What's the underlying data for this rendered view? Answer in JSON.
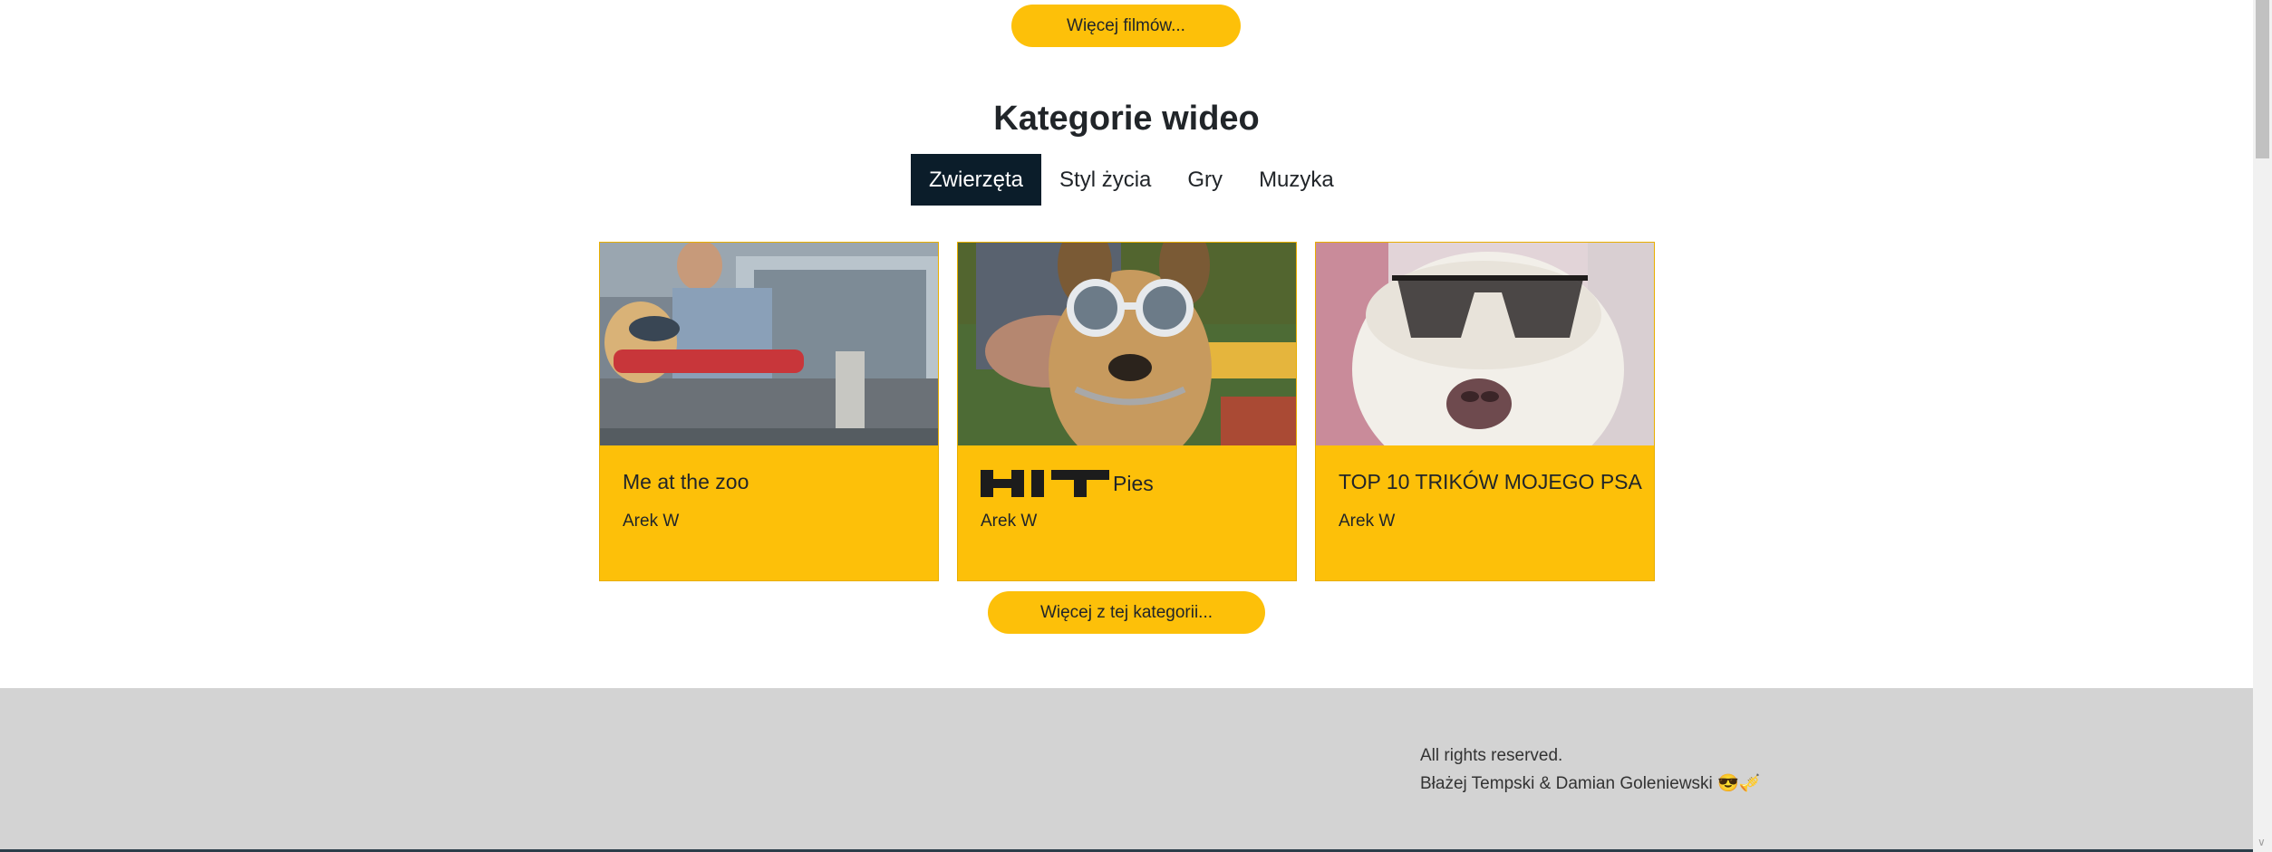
{
  "buttons": {
    "more_films": "Więcej filmów...",
    "more_category": "Więcej z tej kategorii..."
  },
  "categories": {
    "title": "Kategorie wideo",
    "tabs": [
      "Zwierzęta",
      "Styl życia",
      "Gry",
      "Muzyka"
    ],
    "active_tab": "Zwierzęta"
  },
  "videos": [
    {
      "title": "Me at the zoo",
      "author": "Arek W",
      "badge": ""
    },
    {
      "title": "Pies",
      "author": "Arek W",
      "badge": "HIT"
    },
    {
      "title": "TOP 10 TRIKÓW MOJEGO PSA",
      "author": "Arek W",
      "badge": ""
    }
  ],
  "footer": {
    "rights": "All rights reserved.",
    "authors": "Błażej Tempski & Damian Goleniewski",
    "emojis": "😎🎺"
  },
  "colors": {
    "accent": "#fdc009",
    "active_tab": "#0b1d2a",
    "footer_bg": "#d3d3d3"
  }
}
